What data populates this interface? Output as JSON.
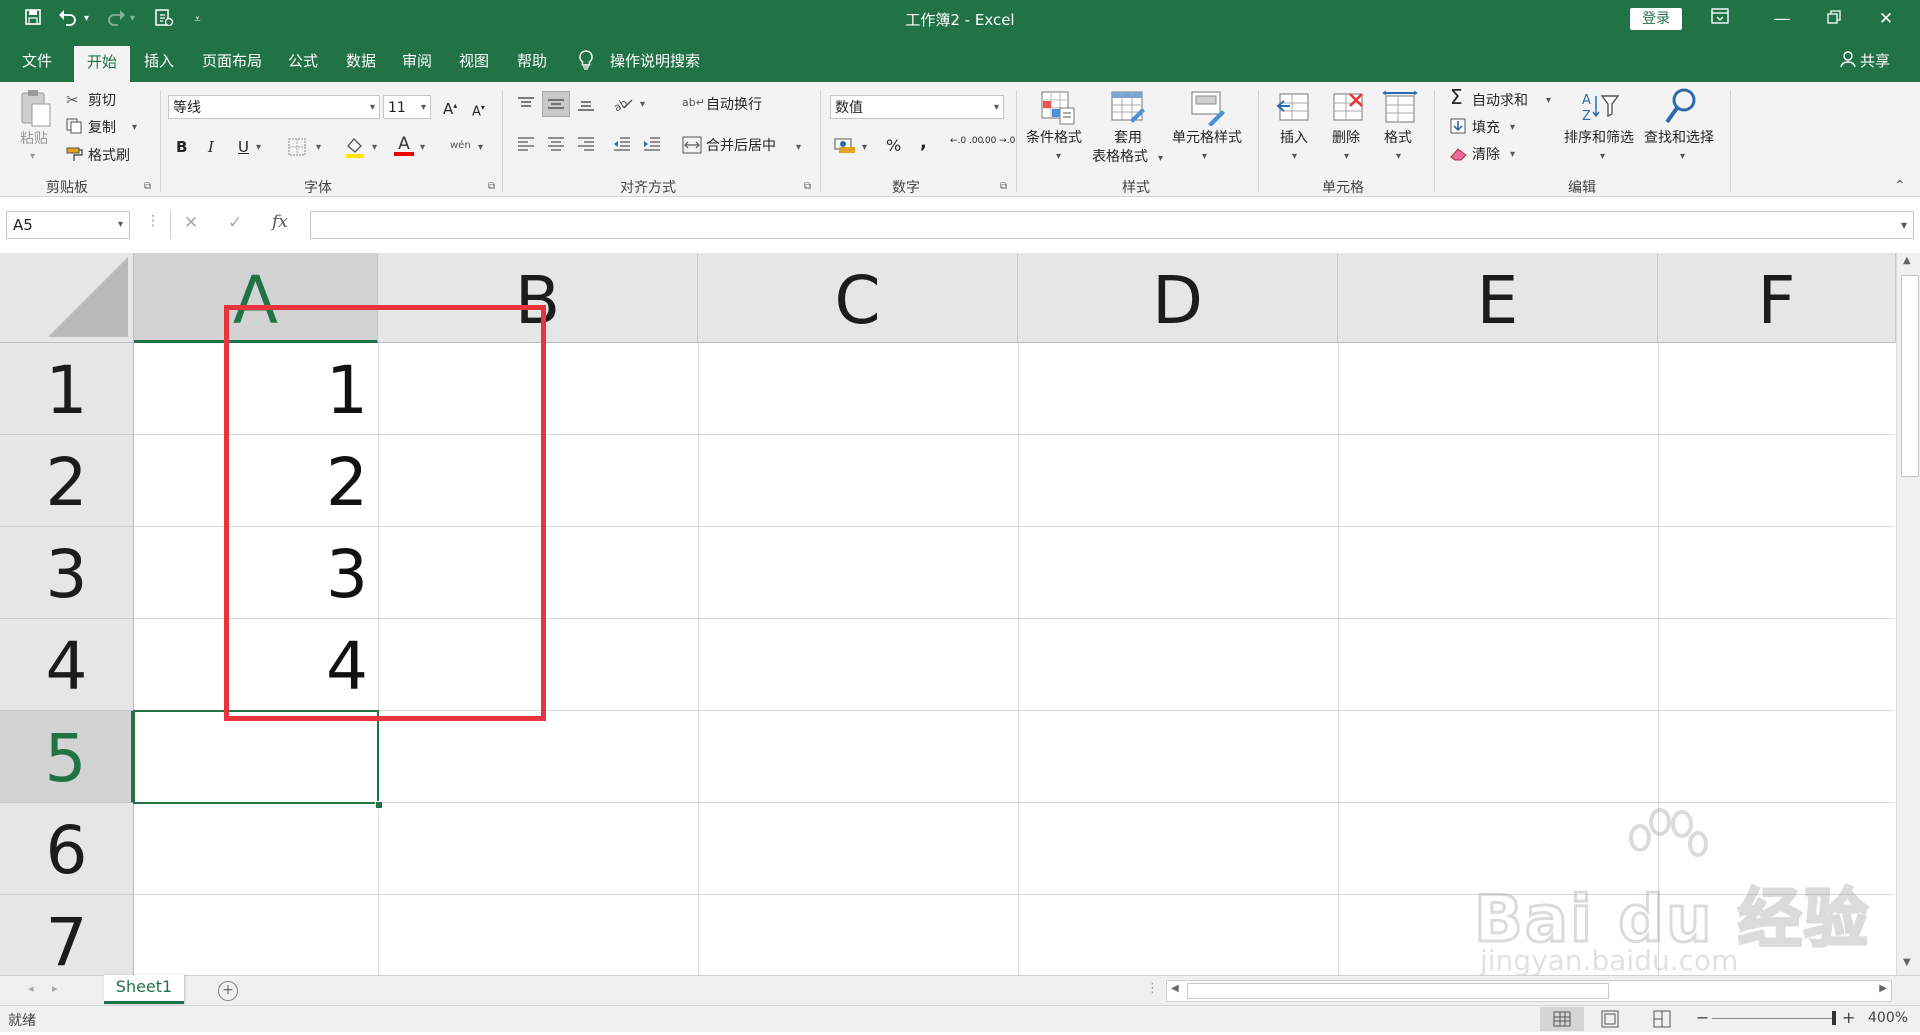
{
  "window": {
    "title": "工作簿2  -  Excel",
    "login_label": "登录",
    "ribbon_display_icon": "ribbon-display-icon",
    "minimize_icon": "minimize-icon",
    "restore_icon": "restore-icon",
    "close_icon": "close-icon"
  },
  "quick_access": {
    "save_icon": "save-icon",
    "undo_icon": "undo-icon",
    "redo_icon": "redo-icon",
    "touch_mode_icon": "touch-mode-icon",
    "customize_icon": "customize-icon"
  },
  "tabs": {
    "file": "文件",
    "home": "开始",
    "insert": "插入",
    "page_layout": "页面布局",
    "formulas": "公式",
    "data": "数据",
    "review": "审阅",
    "view": "视图",
    "help": "帮助",
    "tell_me": "操作说明搜索",
    "share": "共享"
  },
  "ribbon": {
    "clipboard": {
      "paste": "粘贴",
      "cut": "剪切",
      "copy": "复制",
      "format_painter": "格式刷",
      "group": "剪贴板"
    },
    "font": {
      "font_name": "等线",
      "font_size": "11",
      "bold": "B",
      "italic": "I",
      "underline": "U",
      "font_color_letter": "A",
      "phonetic": "wén",
      "grow": "A",
      "shrink": "A",
      "group": "字体"
    },
    "alignment": {
      "wrap_text": "自动换行",
      "merge_center": "合并后居中",
      "group": "对齐方式"
    },
    "number": {
      "format": "数值",
      "percent": "%",
      "comma": ",",
      "inc_decimal": "←.0 .00",
      "dec_decimal": ".00 →.0",
      "group": "数字"
    },
    "styles": {
      "conditional": "条件格式",
      "table_line1": "套用",
      "table_line2": "表格格式",
      "cell_styles": "单元格样式",
      "group": "样式"
    },
    "cells": {
      "insert": "插入",
      "delete": "删除",
      "format": "格式",
      "group": "单元格"
    },
    "editing": {
      "autosum": "自动求和",
      "fill": "填充",
      "clear": "清除",
      "sort_filter": "排序和筛选",
      "find_select": "查找和选择",
      "group": "编辑"
    }
  },
  "formula_bar": {
    "name_box": "A5",
    "cancel": "✕",
    "enter": "✓",
    "fx": "fx",
    "value": ""
  },
  "grid": {
    "columns": [
      "A",
      "B",
      "C",
      "D",
      "E",
      "F"
    ],
    "rows": [
      "1",
      "2",
      "3",
      "4",
      "5",
      "6",
      "7"
    ],
    "cells": [
      {
        "ref": "A1",
        "value": "1"
      },
      {
        "ref": "A2",
        "value": "2"
      },
      {
        "ref": "A3",
        "value": "3"
      },
      {
        "ref": "A4",
        "value": "4"
      }
    ],
    "active_cell": "A5",
    "highlight_color": "#e8343b"
  },
  "sheets": {
    "tabs": [
      "Sheet1"
    ],
    "add_icon": "plus-icon"
  },
  "status": {
    "ready": "就绪",
    "zoom": "400%",
    "zoom_minus": "−",
    "zoom_plus": "+"
  },
  "watermark": {
    "brand": "Bai du 经验",
    "url": "jingyan.baidu.com"
  },
  "colors": {
    "accent": "#217346",
    "ribbon_bg": "#f3f3f3",
    "header_bg": "#e6e6e6"
  }
}
